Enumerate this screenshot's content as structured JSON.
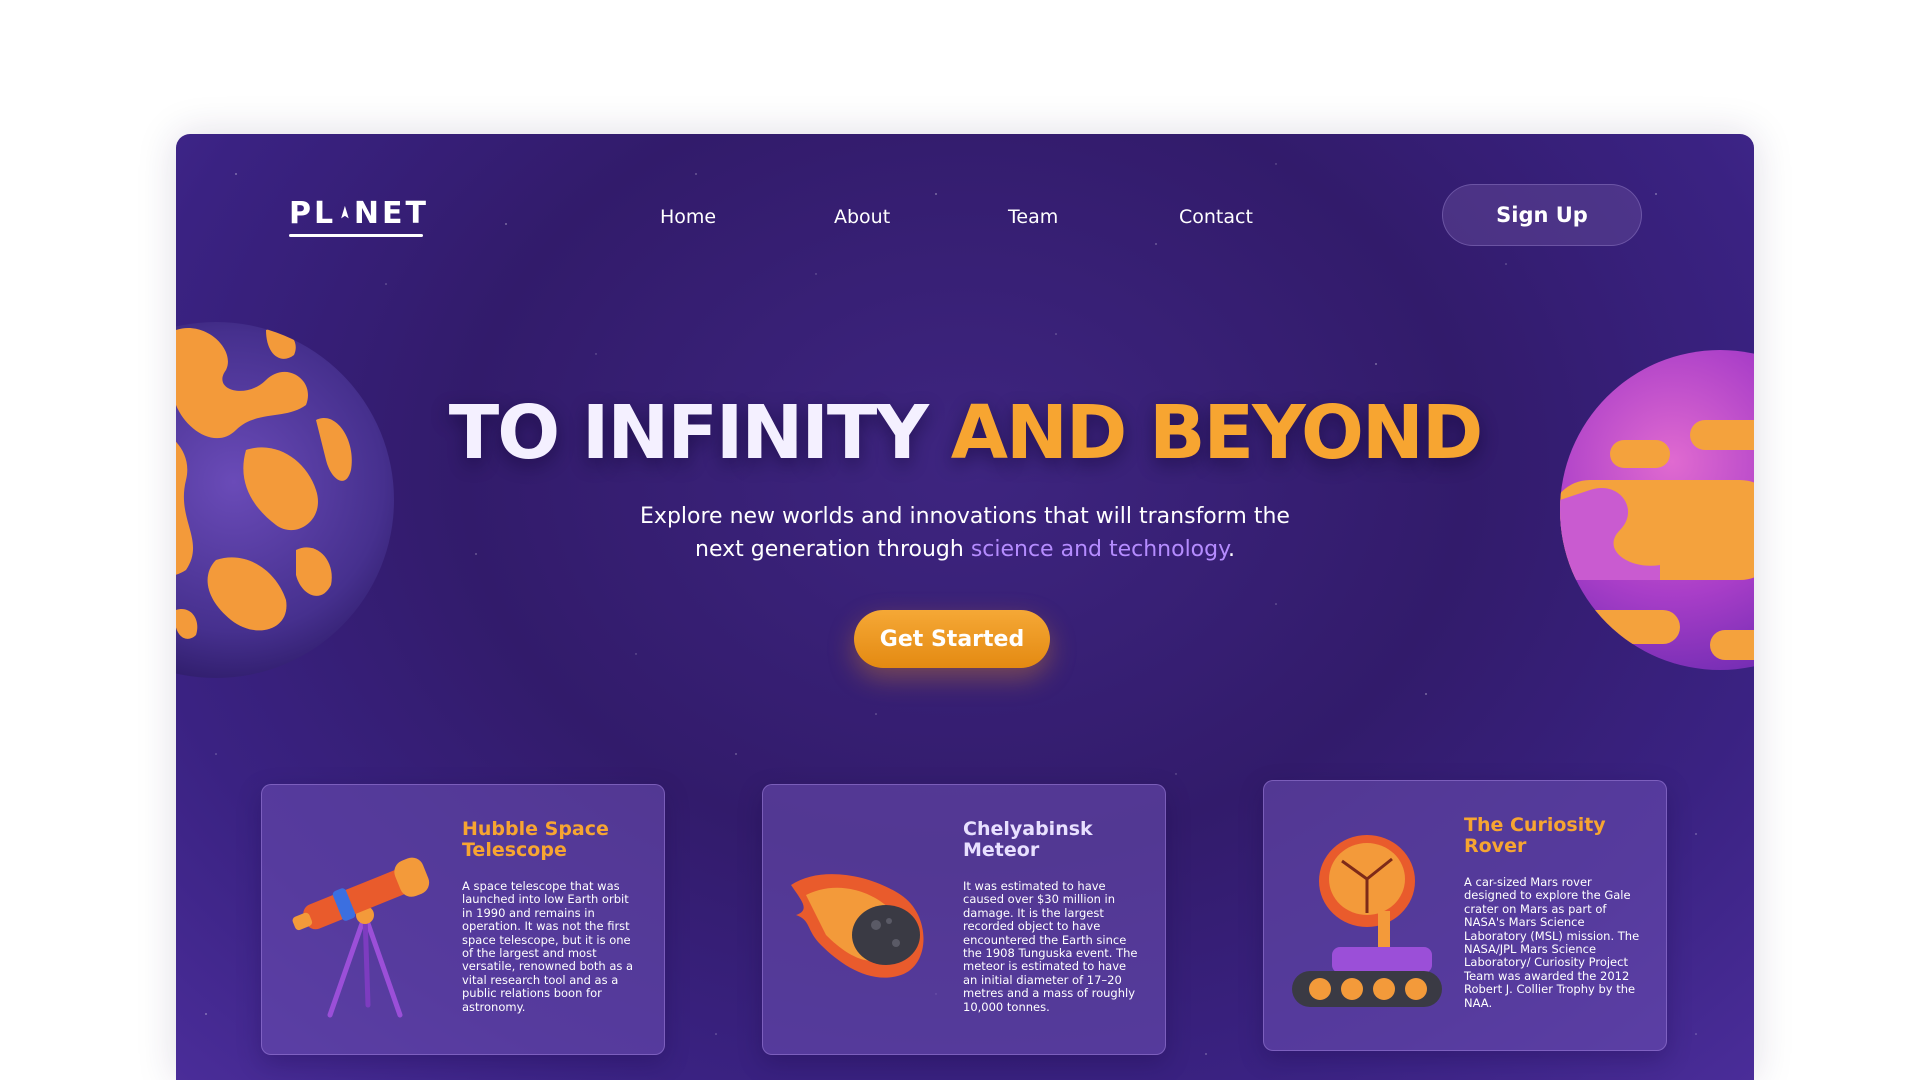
{
  "header": {
    "logo_text_left": "PL",
    "logo_text_right": "NET",
    "nav": [
      {
        "label": "Home"
      },
      {
        "label": "About"
      },
      {
        "label": "Team"
      },
      {
        "label": "Contact"
      }
    ],
    "signup_label": "Sign Up"
  },
  "hero": {
    "title_white": "TO INFINITY ",
    "title_orange": "AND BEYOND",
    "subtitle_line1": "Explore new worlds and innovations that will transform the",
    "subtitle_line2_start": "next generation through ",
    "subtitle_highlight": "science and technology",
    "subtitle_end": ".",
    "cta_label": "Get Started"
  },
  "cards": [
    {
      "title": "Hubble Space Telescope",
      "body": "A space telescope that was launched into low Earth orbit in 1990 and remains in operation. It was not the first space telescope, but it is one of the largest and most versatile, renowned both as a vital research tool and as a public relations boon for astronomy.",
      "icon": "telescope-icon"
    },
    {
      "title": "Chelyabinsk Meteor",
      "body": "It was estimated to have caused over $30 million in damage. It is the largest recorded object to have encountered the Earth since the 1908 Tunguska event. The meteor is estimated to have an initial diameter of 17–20 metres and a mass of roughly 10,000 tonnes.",
      "icon": "meteor-icon"
    },
    {
      "title": "The Curiosity Rover",
      "body": "A car-sized Mars rover designed to explore the Gale crater on Mars as part of NASA's Mars Science Laboratory (MSL) mission. The NASA/JPL Mars Science Laboratory/ Curiosity Project Team was awarded the 2012 Robert J. Collier Trophy by the NAA.",
      "icon": "rover-icon"
    }
  ],
  "colors": {
    "background": "#321b6b",
    "accent_orange": "#f7a531",
    "highlight_purple": "#b58cff",
    "card_bg": "#6e50b4"
  }
}
